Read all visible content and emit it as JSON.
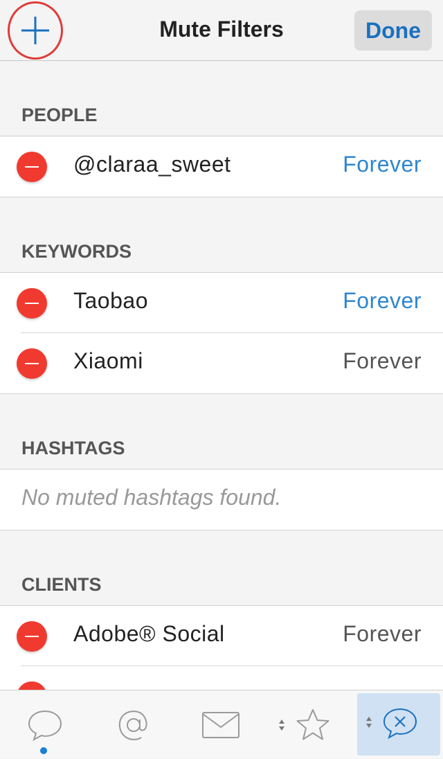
{
  "nav": {
    "title": "Mute Filters",
    "done_label": "Done"
  },
  "sections": {
    "people": {
      "header": "PEOPLE",
      "rows": [
        {
          "label": "@claraa_sweet",
          "duration": "Forever"
        }
      ]
    },
    "keywords": {
      "header": "KEYWORDS",
      "rows": [
        {
          "label": "Taobao",
          "duration": "Forever"
        },
        {
          "label": "Xiaomi",
          "duration": "Forever"
        }
      ]
    },
    "hashtags": {
      "header": "HASHTAGS",
      "empty_text": "No muted hashtags found."
    },
    "clients": {
      "header": "CLIENTS",
      "rows": [
        {
          "label": "Adobe® Social",
          "duration": "Forever"
        }
      ]
    }
  },
  "colors": {
    "accent": "#2d86d0",
    "delete": "#f13a2f",
    "highlight_circle": "#e03b3b",
    "tab_compose_bg": "#cfe1f3"
  },
  "tabbar": {
    "items": [
      {
        "icon": "speech-bubble-icon",
        "active": true
      },
      {
        "icon": "at-sign-icon"
      },
      {
        "icon": "envelope-icon"
      },
      {
        "icon": "star-icon"
      },
      {
        "icon": "compose-bubble-icon"
      }
    ]
  }
}
